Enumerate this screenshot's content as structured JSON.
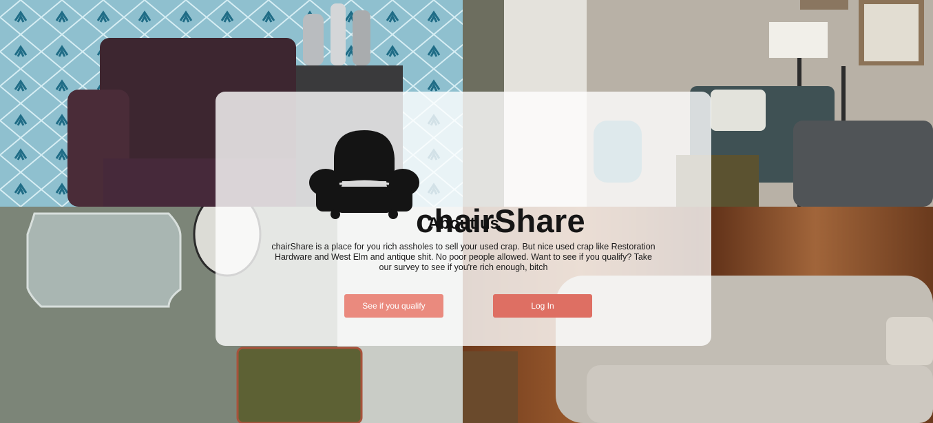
{
  "brand": {
    "name": "chairShare"
  },
  "about": {
    "title": "About us",
    "text": "chairShare is a place for you rich assholes to sell your used crap. But nice used crap like Restoration Hardware and West Elm and antique shit. No poor people allowed. Want to see if you qualify? Take our survey to see if you're rich enough, bitch"
  },
  "actions": {
    "qualify_label": "See if you qualify",
    "login_label": "Log In"
  },
  "colors": {
    "qualify_button": "#ea8a7e",
    "login_button": "#de6f63",
    "card": "rgba(255,255,255,0.80)"
  },
  "icons": {
    "logo": "armchair-icon"
  }
}
